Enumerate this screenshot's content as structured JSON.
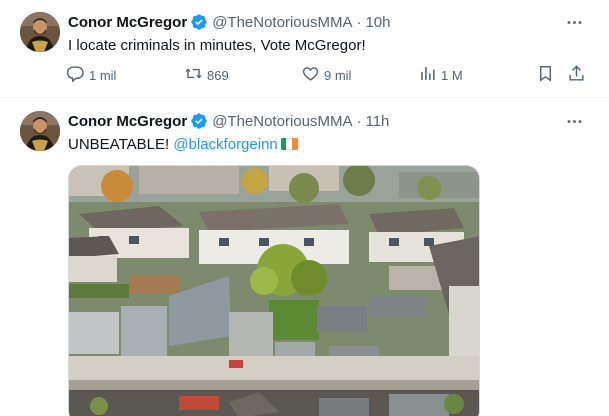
{
  "tweets": [
    {
      "author": "Conor McGregor",
      "handle": "@TheNotoriousMMA",
      "separator": "·",
      "time": "10h",
      "text": "I locate criminals in minutes, Vote McGregor!",
      "replies": "1 mil",
      "retweets": "869",
      "likes": "9 mil",
      "views": "1 M"
    },
    {
      "author": "Conor McGregor",
      "handle": "@TheNotoriousMMA",
      "separator": "·",
      "time": "11h",
      "text": "UNBEATABLE!",
      "mention": "@blackforgeinn",
      "flag_colors": [
        "#169b62",
        "#ffffff",
        "#ff883e"
      ]
    }
  ],
  "colors": {
    "verified": "#1d9bf0",
    "link": "#1d9bf0",
    "muted": "#536471"
  }
}
